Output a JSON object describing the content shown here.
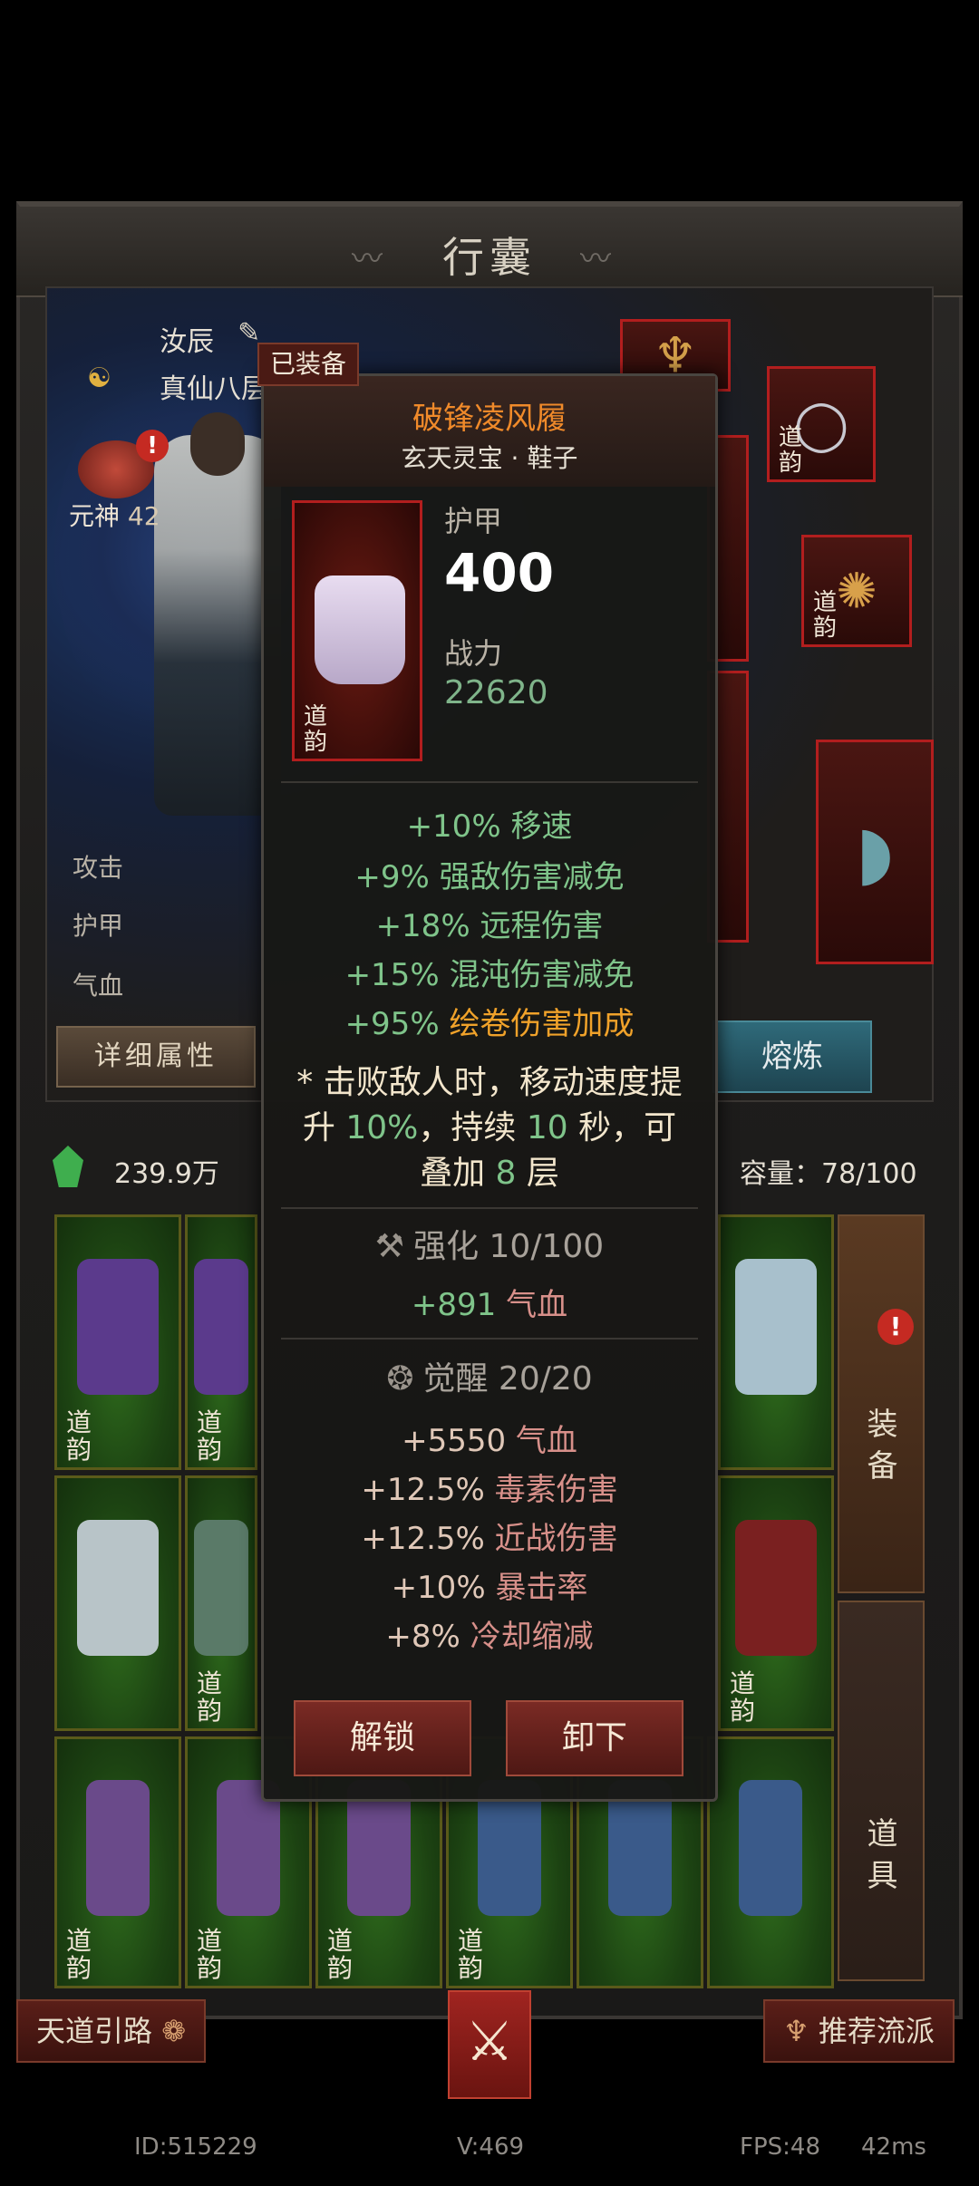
{
  "window": {
    "title": "行囊"
  },
  "character": {
    "name": "汝辰",
    "realm": "真仙八层",
    "soul_label": "元神",
    "soul_level": "42",
    "stats": [
      "攻击",
      "护甲",
      "气血"
    ],
    "detail_button": "详细属性",
    "smelt_button": "熔炼"
  },
  "equipped_slots": [
    {
      "tag": "道韵",
      "icon": "necklace-icon"
    },
    {
      "tag": "道韵",
      "icon": "ring-icon"
    },
    {
      "tag": "",
      "icon": "fan-icon"
    }
  ],
  "currency": {
    "amount": "239.9万",
    "icon": "jade-gem-icon"
  },
  "capacity": {
    "label": "容量：78/100"
  },
  "side_tabs": {
    "equipment": "装备",
    "items": "道具"
  },
  "inventory": [
    {
      "tag": "道韵",
      "color": "#5b3a8c",
      "type": "robe"
    },
    {
      "tag": "道韵",
      "color": "#5b3a8c",
      "type": "robe"
    },
    {
      "tag": "",
      "color": "#a8c0cc",
      "type": "robe"
    },
    {
      "tag": "",
      "color": "#b8c4c8",
      "type": "robe"
    },
    {
      "tag": "道韵",
      "color": "#5a7a68",
      "type": "robe"
    },
    {
      "tag": "道韵",
      "color": "#7a2020",
      "type": "robe"
    },
    {
      "tag": "道韵",
      "color": "#6a4a8a",
      "type": "boots"
    },
    {
      "tag": "道韵",
      "color": "#6a4a8a",
      "type": "boots"
    },
    {
      "tag": "道韵",
      "color": "#6a4a8a",
      "type": "boots"
    },
    {
      "tag": "道韵",
      "color": "#3a5a8a",
      "type": "boots"
    },
    {
      "tag": "",
      "color": "#3a5a8a",
      "type": "boots"
    },
    {
      "tag": "",
      "color": "#3a5a8a",
      "type": "boots"
    }
  ],
  "bottom": {
    "left_button": "天道引路",
    "right_button": "推荐流派",
    "center_icon": "crossed-swords-icon"
  },
  "footer": {
    "id": "ID:515229",
    "version": "V:469",
    "fps": "FPS:48",
    "latency": "42ms"
  },
  "tooltip": {
    "badge": "已装备",
    "name": "破锋凌风履",
    "subtitle": "玄天灵宝 · 鞋子",
    "icon_tag": "道韵",
    "armor_label": "护甲",
    "armor_value": "400",
    "power_label": "战力",
    "power_value": "22620",
    "base_attrs": [
      {
        "num": "+10%",
        "text": "移速"
      },
      {
        "num": "+9%",
        "text": "强敌伤害减免"
      },
      {
        "num": "+18%",
        "text": "远程伤害"
      },
      {
        "num": "+15%",
        "text": "混沌伤害减免"
      },
      {
        "num": "+95%",
        "text": "绘卷伤害加成"
      }
    ],
    "special_line1": "* 击败敌人时，移动速度提",
    "special_line2_a": "升 ",
    "special_line2_b": "10%",
    "special_line2_c": "，持续 ",
    "special_line2_d": "10",
    "special_line2_e": " 秒，可",
    "special_line3_a": "叠加 ",
    "special_line3_b": "8",
    "special_line3_c": " 层",
    "enhance_title": "强化 10/100",
    "enhance_attr": {
      "num": "+891",
      "text": "气血"
    },
    "awaken_title": "觉醒 20/20",
    "awaken_attrs": [
      {
        "num": "+5550",
        "text": "气血"
      },
      {
        "num": "+12.5%",
        "text": "毒素伤害"
      },
      {
        "num": "+12.5%",
        "text": "近战伤害"
      },
      {
        "num": "+10%",
        "text": "暴击率"
      },
      {
        "num": "+8%",
        "text": "冷却缩减"
      }
    ],
    "unlock_button": "解锁",
    "unequip_button": "卸下"
  }
}
